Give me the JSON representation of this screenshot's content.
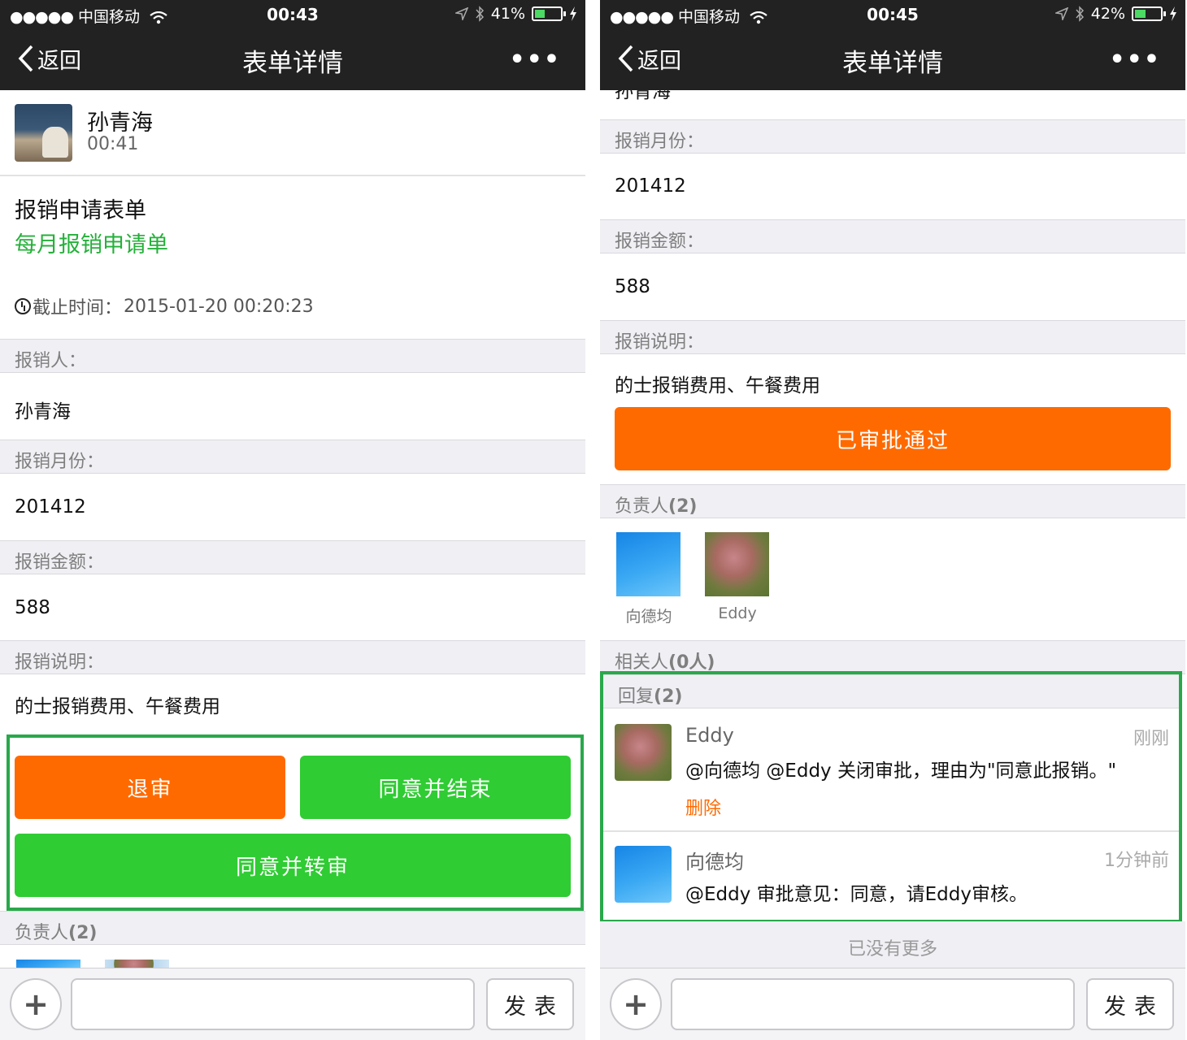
{
  "status_left": {
    "signal": "●●●●●",
    "carrier": "中国移动",
    "time": "00:43",
    "battery": "41%",
    "battery_level": 0.41
  },
  "status_right": {
    "signal": "●●●●●",
    "carrier": "中国移动",
    "time": "00:45",
    "battery": "42%",
    "battery_level": 0.42
  },
  "nav": {
    "back_label": "返回",
    "title": "表单详情",
    "more_label": "•••"
  },
  "author": {
    "name": "孙青海",
    "time": "00:41"
  },
  "form": {
    "title": "报销申请表单",
    "subtitle": "每月报销申请单",
    "deadline_label": "截止时间：",
    "deadline_value": "2015-01-20 00:20:23"
  },
  "fields": {
    "applicant_label": "报销人：",
    "applicant_value": "孙青海",
    "month_label": "报销月份：",
    "month_value": "201412",
    "amount_label": "报销金额：",
    "amount_value": "588",
    "desc_label": "报销说明：",
    "desc_value": "的士报销费用、午餐费用"
  },
  "actions": {
    "reject": "退审",
    "approve_end": "同意并结束",
    "approve_forward": "同意并转审",
    "approved": "已审批通过"
  },
  "partial_top_text": "孙青海",
  "assignees": {
    "label": "负责人",
    "count": "(2)",
    "people": [
      {
        "name": "向德均"
      },
      {
        "name": "Eddy"
      }
    ]
  },
  "related": {
    "label": "相关人",
    "count": "(0人)"
  },
  "replies": {
    "label": "回复",
    "count": "(2)",
    "items": [
      {
        "name": "Eddy",
        "time": "刚刚",
        "text": "@向德均 @Eddy 关闭审批，理由为\"同意此报销。\"",
        "delete": "删除"
      },
      {
        "name": "向德均",
        "time": "1分钟前",
        "text": "@Eddy 审批意见：同意，请Eddy审核。"
      }
    ]
  },
  "no_more": "已没有更多",
  "input_bar": {
    "plus": "+",
    "input_value": "",
    "send": "发表"
  },
  "colors": {
    "orange": "#ff6a00",
    "green": "#2fcc33",
    "highlight": "#29a84a",
    "nav_bg": "#222222"
  }
}
